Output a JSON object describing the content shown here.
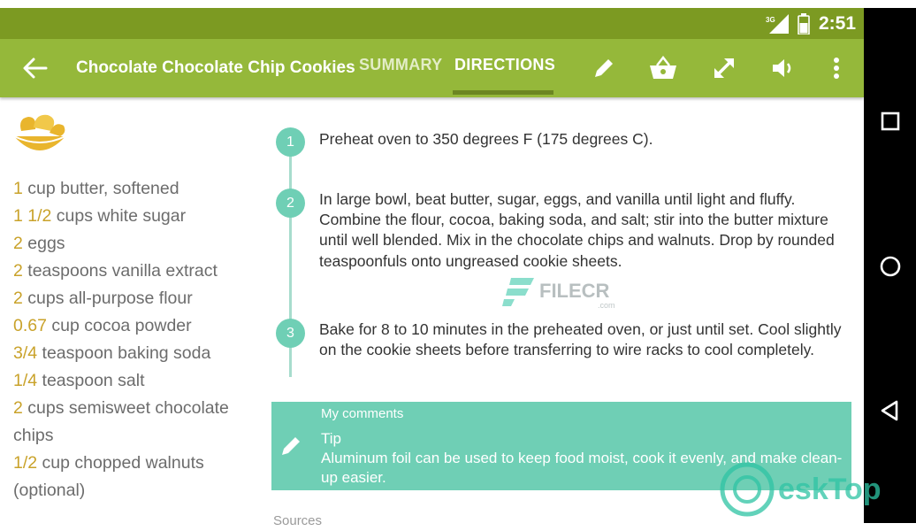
{
  "status_bar": {
    "network": "3G",
    "time": "2:51",
    "color": "#7c9a22"
  },
  "app_bar": {
    "title": "Chocolate Chocolate Chip Cookies",
    "tabs": [
      {
        "label": "SUMMARY",
        "selected": false
      },
      {
        "label": "DIRECTIONS",
        "selected": true
      }
    ],
    "actions": [
      "edit-icon",
      "basket-icon",
      "fullscreen-icon",
      "volume-icon",
      "more-vert-icon"
    ],
    "color": "#95b83a"
  },
  "ingredients": [
    {
      "qty": "1",
      "text": " cup butter, softened"
    },
    {
      "qty": "1 1/2",
      "text": " cups white sugar"
    },
    {
      "qty": "2",
      "text": " eggs"
    },
    {
      "qty": "2",
      "text": " teaspoons vanilla extract"
    },
    {
      "qty": "2",
      "text": " cups all-purpose flour"
    },
    {
      "qty": "0.67",
      "text": " cup cocoa powder"
    },
    {
      "qty": "3/4",
      "text": " teaspoon baking soda"
    },
    {
      "qty": "1/4",
      "text": " teaspoon salt"
    },
    {
      "qty": "2",
      "text": " cups semisweet chocolate chips"
    },
    {
      "qty": "1/2",
      "text": " cup chopped walnuts (optional)"
    }
  ],
  "directions": [
    {
      "num": "1",
      "text": "Preheat oven to 350 degrees F (175 degrees C)."
    },
    {
      "num": "2",
      "text": "In large bowl, beat butter, sugar, eggs, and vanilla until light and fluffy. Combine the flour, cocoa, baking soda, and salt; stir into the butter mixture until well blended. Mix in the chocolate chips and walnuts. Drop by rounded teaspoonfuls onto ungreased cookie sheets."
    },
    {
      "num": "3",
      "text": "Bake for 8 to 10 minutes in the preheated oven, or just until set. Cool slightly on the cookie sheets before transferring to wire racks to cool completely."
    }
  ],
  "comments": {
    "header": "My comments",
    "tip_title": "Tip",
    "tip_text": "Aluminum foil can be used to keep food moist, cook it evenly, and make clean-up easier.",
    "color": "#6fcfb5"
  },
  "sources_label": "Sources",
  "watermarks": {
    "filecr": "FILECR",
    "filecr_sub": ".com",
    "desktop": "eskTop"
  }
}
